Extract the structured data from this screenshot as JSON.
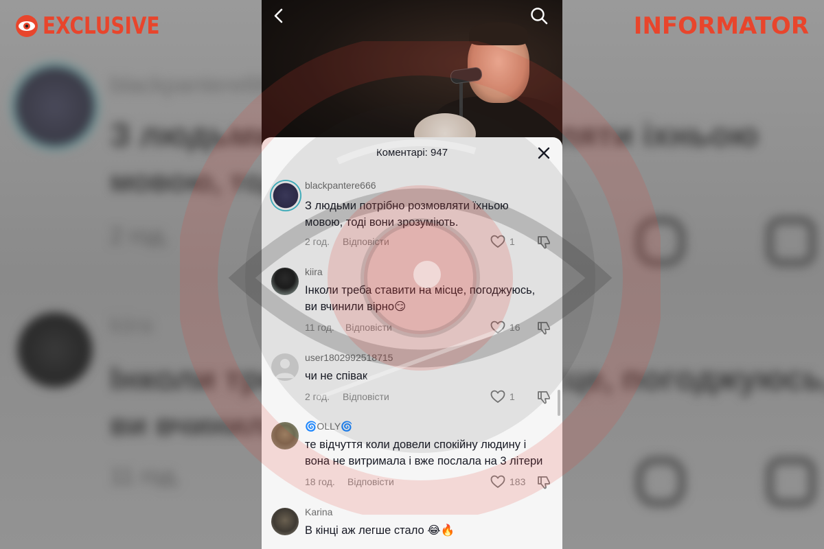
{
  "brand": {
    "left_text": "EXCLUSIVE",
    "right_text": "INFORMATOR",
    "color": "#e8452c"
  },
  "background_blur": {
    "lines": [
      "blackpantere666",
      "З людьми потрібно розмовляти іхньою",
      "мовою, тоді вони",
      "2 год.",
      "kiira",
      "Інколи треба ставити на місце, погоджуюсь,",
      "ви вчинили",
      "11 год."
    ]
  },
  "video": {
    "back_icon": "chevron-left-icon",
    "search_icon": "search-icon"
  },
  "comments_sheet": {
    "title": "Коментарі: 947",
    "close_icon": "close-icon",
    "comments": [
      {
        "user": "blackpantere666",
        "lines": [
          "З людьми потрібно розмовляти їхньою",
          "мовою, тоді вони зрозуміють."
        ],
        "time": "2 год.",
        "reply": "Відповісти",
        "likes": "1"
      },
      {
        "user": "kiira",
        "lines": [
          "Інколи треба ставити на місце, погоджуюсь,",
          "ви вчинили вірно😏"
        ],
        "time": "11 год.",
        "reply": "Відповісти",
        "likes": "16"
      },
      {
        "user": "user1802992518715",
        "lines": [
          "чи не співак"
        ],
        "time": "2 год.",
        "reply": "Відповісти",
        "likes": "1"
      },
      {
        "user": "🌀OLLY🌀",
        "lines": [
          "те відчуття коли довели спокійну людину і",
          "вона не витримала і вже послала на 3 літери"
        ],
        "time": "18 год.",
        "reply": "Відповісти",
        "likes": "183"
      },
      {
        "user": "Karina",
        "lines": [
          "В кінці аж легше стало 😂🔥"
        ],
        "time": "",
        "reply": "",
        "likes": ""
      }
    ]
  },
  "colors": {
    "accent": "#e8452c",
    "sheet_bg": "#f6f6f6",
    "text": "#161823",
    "muted": "#8a8a8a"
  }
}
